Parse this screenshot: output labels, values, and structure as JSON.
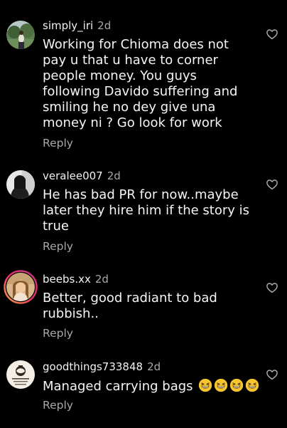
{
  "comments": [
    {
      "username": "simply_iri",
      "time": "2d",
      "text": "Working for Chioma does not pay u that u have to corner people money. You guys following Davido suffering and smiling he no dey give una money ni ? Go look for work",
      "reply": "Reply",
      "avatar_icon": "profile-photo-greenery"
    },
    {
      "username": "veralee007",
      "time": "2d",
      "text": "He has bad PR for now..maybe later they hire him if the story is true",
      "reply": "Reply",
      "avatar_icon": "profile-photo-person"
    },
    {
      "username": "beebs.xx",
      "time": "2d",
      "text": "Better, good radiant to bad rubbish..",
      "reply": "Reply",
      "avatar_icon": "profile-photo-story-ring"
    },
    {
      "username": "goodthings733848",
      "time": "2d",
      "text": "Managed carrying bags",
      "emoji_count": 4,
      "emoji_icon": "grinning-squinting-face-emoji",
      "reply": "Reply",
      "avatar_icon": "profile-photo-logo"
    }
  ],
  "colors": {
    "background": "#000000",
    "text": "#f5f5f5",
    "secondary_text": "#a8a8a8",
    "story_ring": "#c13584"
  },
  "icons": {
    "like": "heart-outline-icon"
  }
}
